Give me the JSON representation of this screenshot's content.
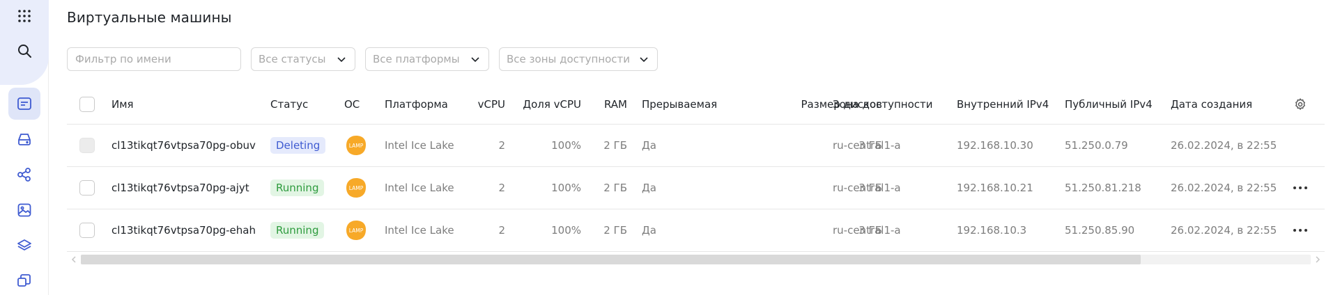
{
  "sidebar": {
    "items": [
      {
        "name": "apps-grid-icon"
      },
      {
        "name": "search-icon"
      },
      {
        "name": "virtual-machines-icon",
        "active": true
      },
      {
        "name": "disk-icon"
      },
      {
        "name": "network-nodes-icon"
      },
      {
        "name": "image-icon"
      },
      {
        "name": "layers-icon"
      },
      {
        "name": "snapshots-icon"
      }
    ]
  },
  "page": {
    "title": "Виртуальные машины"
  },
  "filters": {
    "name_placeholder": "Фильтр по имени",
    "status": "Все статусы",
    "platform": "Все платформы",
    "zone": "Все зоны доступности"
  },
  "table": {
    "headers": {
      "name": "Имя",
      "status": "Статус",
      "os": "ОС",
      "platform": "Платформа",
      "vcpu": "vCPU",
      "vcpu_share": "Доля vCPU",
      "ram": "RAM",
      "preemptible": "Прерываемая",
      "disk_size": "Размер дисков",
      "zone": "Зона доступности",
      "internal_ip": "Внутренний IPv4",
      "public_ip": "Публичный IPv4",
      "created": "Дата создания"
    },
    "rows": [
      {
        "name": "cl13tikqt76vtpsa70pg-obuv",
        "status": "Deleting",
        "os": "LAMP",
        "platform": "Intel Ice Lake",
        "vcpu": "2",
        "vcpu_share": "100%",
        "ram": "2 ГБ",
        "preemptible": "Да",
        "disk_size": "3 ГБ",
        "zone": "ru-central1-a",
        "internal_ip": "192.168.10.30",
        "public_ip": "51.250.0.79",
        "created": "26.02.2024, в 22:55"
      },
      {
        "name": "cl13tikqt76vtpsa70pg-ajyt",
        "status": "Running",
        "os": "LAMP",
        "platform": "Intel Ice Lake",
        "vcpu": "2",
        "vcpu_share": "100%",
        "ram": "2 ГБ",
        "preemptible": "Да",
        "disk_size": "3 ГБ",
        "zone": "ru-central1-a",
        "internal_ip": "192.168.10.21",
        "public_ip": "51.250.81.218",
        "created": "26.02.2024, в 22:55"
      },
      {
        "name": "cl13tikqt76vtpsa70pg-ehah",
        "status": "Running",
        "os": "LAMP",
        "platform": "Intel Ice Lake",
        "vcpu": "2",
        "vcpu_share": "100%",
        "ram": "2 ГБ",
        "preemptible": "Да",
        "disk_size": "3 ГБ",
        "zone": "ru-central1-a",
        "internal_ip": "192.168.10.3",
        "public_ip": "51.250.85.90",
        "created": "26.02.2024, в 22:55"
      }
    ]
  },
  "colors": {
    "deleting_bg": "#e5eafc",
    "deleting_text": "#3f5bd1",
    "running_bg": "#e2f5e4",
    "running_text": "#2e9b3e",
    "lamp_orange": "#f7a928"
  }
}
